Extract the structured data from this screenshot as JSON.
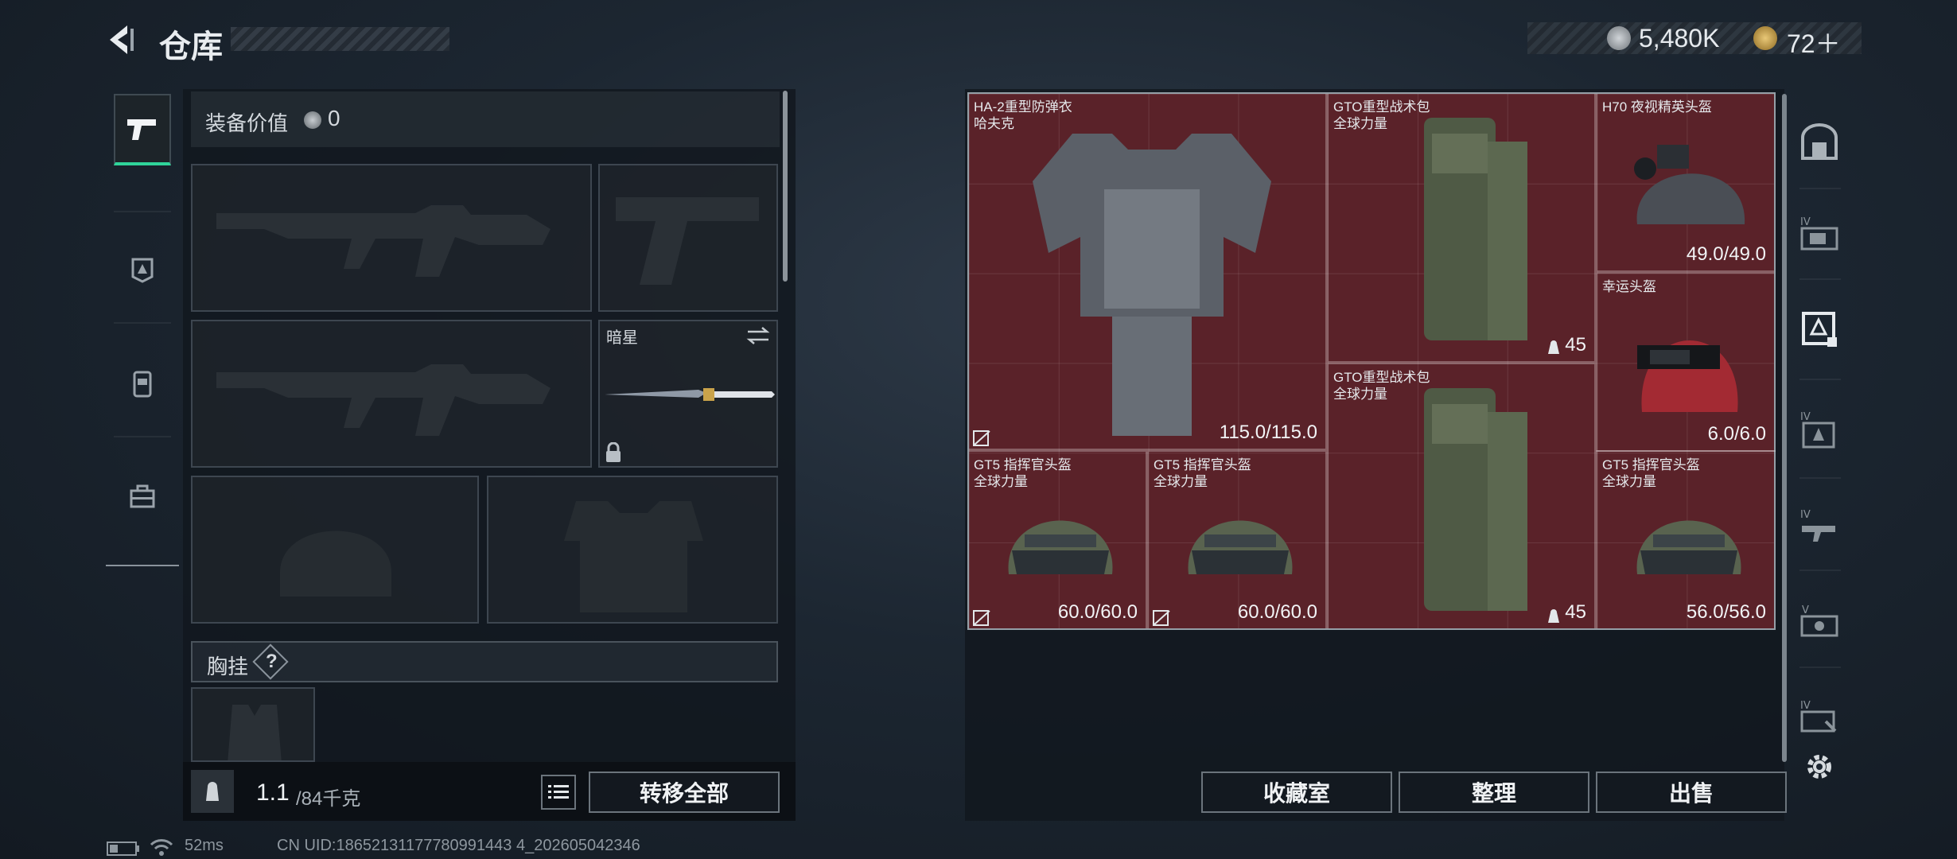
{
  "header": {
    "title": "仓库",
    "currency_a": "5,480K",
    "currency_b": "72＋"
  },
  "equipment": {
    "value_label": "装备价值",
    "value": "0",
    "melee_name": "暗星",
    "chest_label": "胸挂",
    "chest_help": "?",
    "weight_value": "1.1",
    "weight_cap": "/84千克",
    "transfer_all": "转移全部"
  },
  "inventory": {
    "items": [
      {
        "name": "HA-2重型防弹衣\n哈夫克",
        "durability": "115.0/115.0",
        "icon": "body-armor"
      },
      {
        "name": "GTO重型战术包\n全球力量",
        "durability": "45",
        "icon": "backpack"
      },
      {
        "name": "H70 夜视精英头盔",
        "durability": "49.0/49.0",
        "icon": "nvg-helmet"
      },
      {
        "name": "幸运头盔",
        "durability": "6.0/6.0",
        "icon": "red-helmet"
      },
      {
        "name": "GTO重型战术包\n全球力量",
        "durability": "45",
        "icon": "backpack"
      },
      {
        "name": "GT5 指挥官头盔\n全球力量",
        "durability": "60.0/60.0",
        "icon": "commander-helmet"
      },
      {
        "name": "GT5 指挥官头盔\n全球力量",
        "durability": "60.0/60.0",
        "icon": "commander-helmet"
      },
      {
        "name": "GT5 指挥官头盔\n全球力量",
        "durability": "56.0/56.0",
        "icon": "commander-helmet"
      }
    ],
    "buttons": {
      "collection": "收藏室",
      "sort": "整理",
      "sell": "出售"
    }
  },
  "status": {
    "ping": "52ms",
    "uid": "CN UID:18652131177780991443 4_202605042346"
  },
  "colors": {
    "grid_bg": "#5a2229",
    "accent_green": "#2fd49a"
  }
}
